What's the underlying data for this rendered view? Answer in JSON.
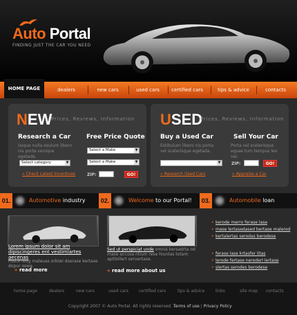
{
  "header": {
    "logo_part1": "Auto",
    "logo_part2": "Portal",
    "tagline": "FINDING JUST THE CAR YOU NEED"
  },
  "nav": {
    "items": [
      {
        "label": "HOME PAGE"
      },
      {
        "label": "dealers"
      },
      {
        "label": "new cars"
      },
      {
        "label": "used cars"
      },
      {
        "label": "certified cars"
      },
      {
        "label": "tips & advice"
      },
      {
        "label": "contacts"
      }
    ]
  },
  "new_box": {
    "big": "NEW",
    "sub": "Prices, Reviews, Information",
    "research": {
      "title": "Research a Car",
      "text": "Usque nulla esulum libero nis porta venique egetada.",
      "select": "Select category",
      "link": "Check Latest Incentives"
    },
    "quote": {
      "title": "Free Price Quote",
      "select1": "Select a Make",
      "select2": "Select a Make",
      "zip_label": "ZIP:",
      "go": "GO!"
    }
  },
  "used_box": {
    "big": "USED",
    "sub": "Prices, Reviews, Information",
    "buy": {
      "title": "Buy a Used Car",
      "text": "Estibulum libero nis porta vel scelerisque egetada.",
      "link": "Research Used Cars"
    },
    "sell": {
      "title": "Sell Your Car",
      "text": "Porta vel scelerisque egsae tum tempus leo vel.",
      "zip_label": "ZIP:",
      "go": "GO!",
      "link": "Appraise a Car"
    }
  },
  "strip": [
    {
      "num": "01.",
      "hl": "Automotive",
      "rest": " industry"
    },
    {
      "num": "02.",
      "hl": "Welcome",
      "rest": " to our Portal!"
    },
    {
      "num": "03.",
      "hl": "Automobile",
      "rest": " loan"
    }
  ],
  "feature1": {
    "title": "Lorem ipsum dolor sit am dipiscingeres ent vestimlartes aecenas",
    "text": "Fusce feug maleuas orbiwi dserase kertase dopur oswa.",
    "more": "read more"
  },
  "feature2": {
    "title": "Sed ut perspiciat unde",
    "title_rest": " omnis kersadrta",
    "text": "od mase accusa ntium rese hiuntas totam aptilollert servertase.",
    "more": "read more about us"
  },
  "links1": [
    "kerode merro ferase lase",
    "mase lertasedased bertase malerod",
    "kertalertas serodas berodese"
  ],
  "links2": [
    "ferase lase krtasfer litas",
    "lerode fertase neroderl lertase",
    "slertas serodes berodese"
  ],
  "footer": {
    "nav": [
      "home page",
      "dealers",
      "new cars",
      "used cars",
      "certified cars",
      "tips & advice",
      "links",
      "site map",
      "contacts"
    ],
    "copyright": "Copyright 2007 © Auto Portal. All rights reserved.",
    "terms": "Terms of use",
    "privacy": "Privacy Policy"
  }
}
